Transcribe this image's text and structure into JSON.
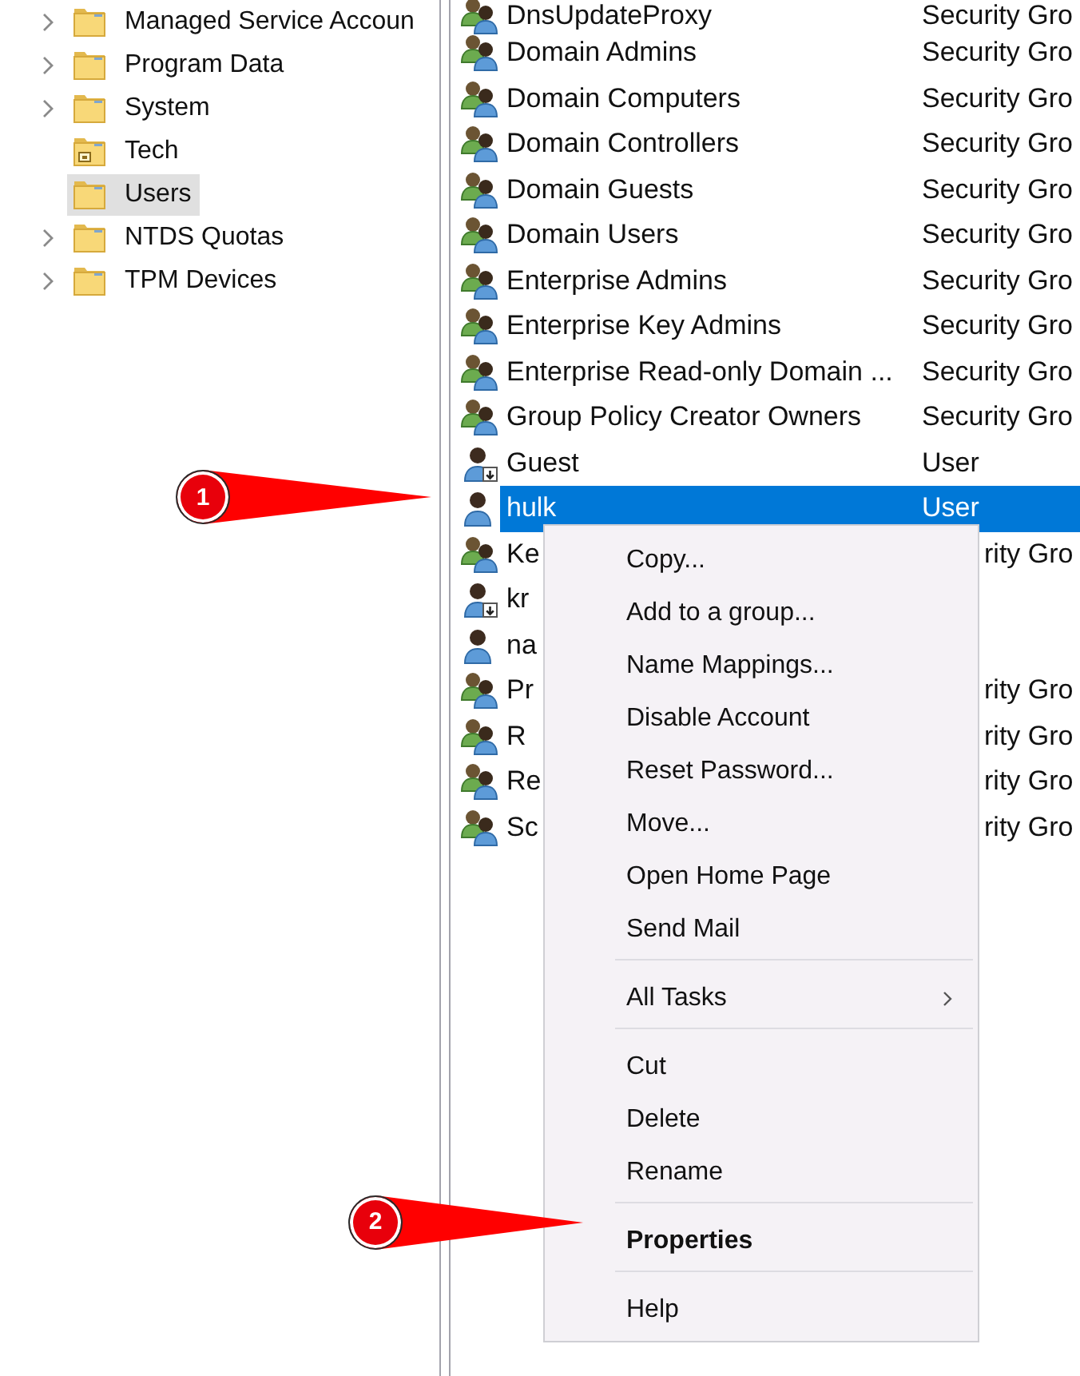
{
  "tree": {
    "items": [
      {
        "kind": "container",
        "label": "Managed Service Accoun",
        "expandable": true,
        "selected": false
      },
      {
        "kind": "container",
        "label": "Program Data",
        "expandable": true,
        "selected": false
      },
      {
        "kind": "container",
        "label": "System",
        "expandable": true,
        "selected": false
      },
      {
        "kind": "ou",
        "label": "Tech",
        "expandable": false,
        "selected": false
      },
      {
        "kind": "container",
        "label": "Users",
        "expandable": false,
        "selected": true
      },
      {
        "kind": "container",
        "label": "NTDS Quotas",
        "expandable": true,
        "selected": false
      },
      {
        "kind": "container",
        "label": "TPM Devices",
        "expandable": true,
        "selected": false
      }
    ]
  },
  "list": {
    "rows": [
      {
        "kind": "group",
        "name": "DnsUpdateProxy",
        "type": "Security Gro",
        "selected": false
      },
      {
        "kind": "group",
        "name": "Domain Admins",
        "type": "Security Gro",
        "selected": false
      },
      {
        "kind": "group",
        "name": "Domain Computers",
        "type": "Security Gro",
        "selected": false
      },
      {
        "kind": "group",
        "name": "Domain Controllers",
        "type": "Security Gro",
        "selected": false
      },
      {
        "kind": "group",
        "name": "Domain Guests",
        "type": "Security Gro",
        "selected": false
      },
      {
        "kind": "group",
        "name": "Domain Users",
        "type": "Security Gro",
        "selected": false
      },
      {
        "kind": "group",
        "name": "Enterprise Admins",
        "type": "Security Gro",
        "selected": false
      },
      {
        "kind": "group",
        "name": "Enterprise Key Admins",
        "type": "Security Gro",
        "selected": false
      },
      {
        "kind": "group",
        "name": "Enterprise Read-only Domain ...",
        "type": "Security Gro",
        "selected": false
      },
      {
        "kind": "group",
        "name": "Group Policy Creator Owners",
        "type": "Security Gro",
        "selected": false
      },
      {
        "kind": "disabled_user",
        "name": "Guest",
        "type": "User",
        "selected": false
      },
      {
        "kind": "user",
        "name": "hulk",
        "type": "User",
        "selected": true,
        "callout": "1"
      },
      {
        "kind": "group",
        "name": "Ke",
        "type": "rity Gro",
        "selected": false
      },
      {
        "kind": "disabled_user",
        "name": "kr",
        "selected": false
      },
      {
        "kind": "user",
        "name": "na",
        "selected": false
      },
      {
        "kind": "group",
        "name": "Pr",
        "type": "rity Gro",
        "selected": false
      },
      {
        "kind": "group",
        "name": "R",
        "type": "rity Gro",
        "selected": false
      },
      {
        "kind": "group",
        "name": "Re",
        "type": "rity Gro",
        "selected": false
      },
      {
        "kind": "group",
        "name": "Sc",
        "type": "rity Gro",
        "selected": false
      }
    ]
  },
  "context_menu": {
    "items": [
      {
        "kind": "item",
        "label": "Copy...",
        "default": false,
        "submenu": false
      },
      {
        "kind": "item",
        "label": "Add to a group...",
        "default": false,
        "submenu": false
      },
      {
        "kind": "item",
        "label": "Name Mappings...",
        "default": false,
        "submenu": false
      },
      {
        "kind": "item",
        "label": "Disable Account",
        "default": false,
        "submenu": false
      },
      {
        "kind": "item",
        "label": "Reset Password...",
        "default": false,
        "submenu": false
      },
      {
        "kind": "item",
        "label": "Move...",
        "default": false,
        "submenu": false
      },
      {
        "kind": "item",
        "label": "Open Home Page",
        "default": false,
        "submenu": false
      },
      {
        "kind": "item",
        "label": "Send Mail",
        "default": false,
        "submenu": false
      },
      {
        "kind": "separator"
      },
      {
        "kind": "item",
        "label": "All Tasks",
        "default": false,
        "submenu": true
      },
      {
        "kind": "separator"
      },
      {
        "kind": "item",
        "label": "Cut",
        "default": false,
        "submenu": false
      },
      {
        "kind": "item",
        "label": "Delete",
        "default": false,
        "submenu": false
      },
      {
        "kind": "item",
        "label": "Rename",
        "default": false,
        "submenu": false
      },
      {
        "kind": "separator"
      },
      {
        "kind": "item",
        "label": "Properties",
        "default": true,
        "submenu": false,
        "callout": "2"
      },
      {
        "kind": "separator"
      },
      {
        "kind": "item",
        "label": "Help",
        "default": false,
        "submenu": false
      }
    ]
  }
}
